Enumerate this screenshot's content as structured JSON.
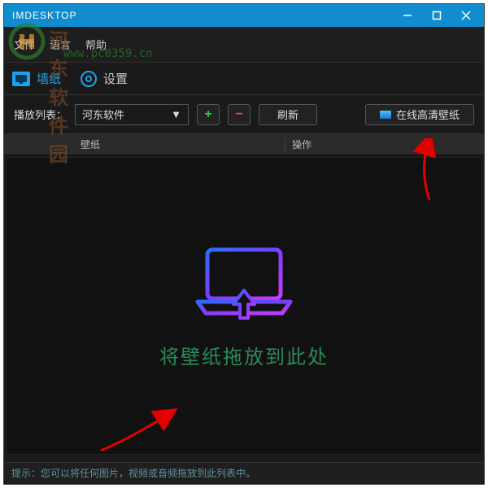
{
  "window": {
    "title": "IMDESKTOP"
  },
  "watermark": {
    "text": "河东软件园",
    "url": "www.pc0359.cn"
  },
  "menubar": {
    "items": [
      "文件",
      "语言",
      "帮助"
    ]
  },
  "tabs": {
    "wallpaper": "墙纸",
    "settings": "设置"
  },
  "toolbar": {
    "playlist_label": "播放列表：",
    "combo_value": "河东软件",
    "refresh": "刷新",
    "online_hd": "在线高清壁纸"
  },
  "headers": {
    "wallpaper": "壁纸",
    "operation": "操作"
  },
  "dropzone": {
    "text": "将壁纸拖放到此处"
  },
  "status": {
    "hint": "提示：您可以将任何图片，视频或音频拖放到此列表中。"
  }
}
